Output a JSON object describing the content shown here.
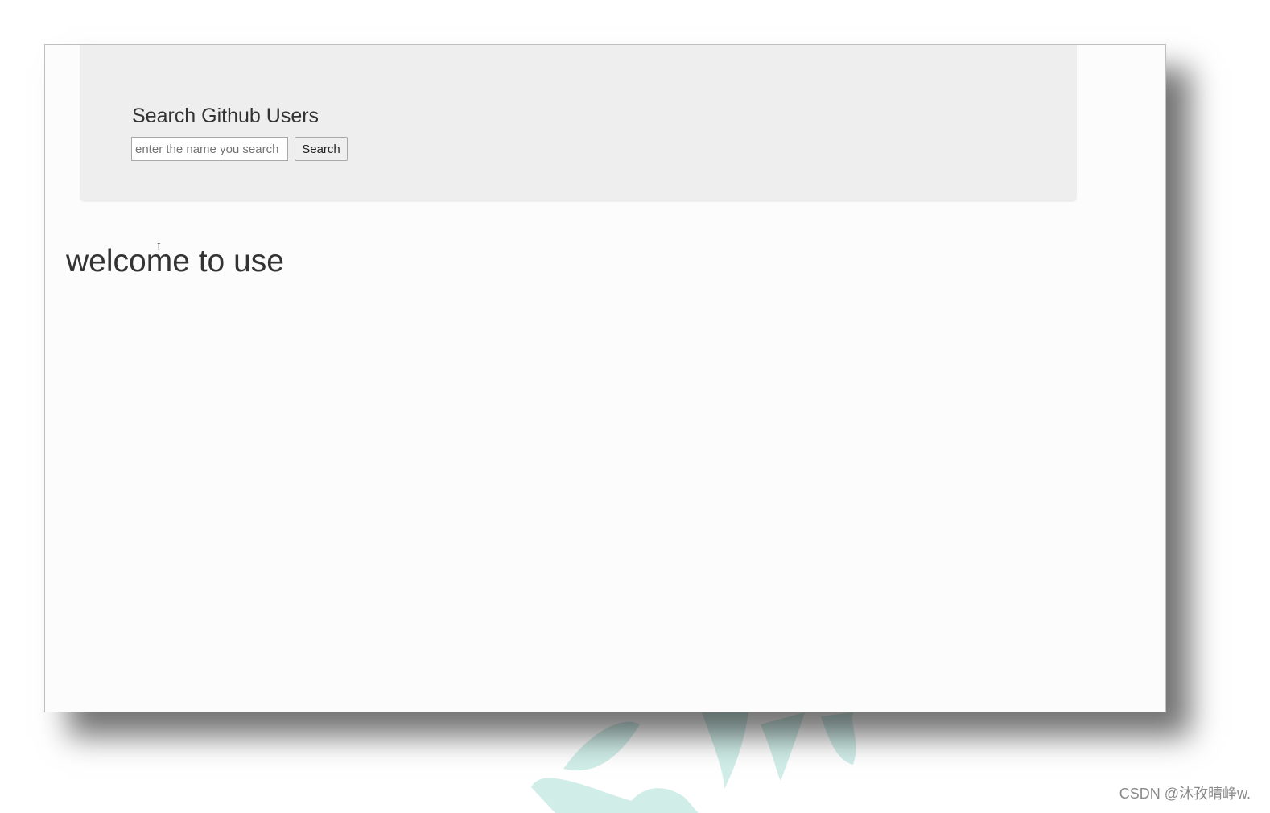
{
  "header": {
    "title": "Search Github Users"
  },
  "search": {
    "placeholder": "enter the name you search",
    "value": "",
    "button_label": "Search"
  },
  "main": {
    "message": "welcome to use"
  },
  "overlay": {
    "cursor_glyph": "I",
    "watermark": "CSDN @沐孜晴峥w."
  },
  "colors": {
    "jumbotron_bg": "#eeeeee",
    "page_bg": "#fcfcfc",
    "text": "#333333",
    "watermark_art": "#5bbfb0"
  }
}
